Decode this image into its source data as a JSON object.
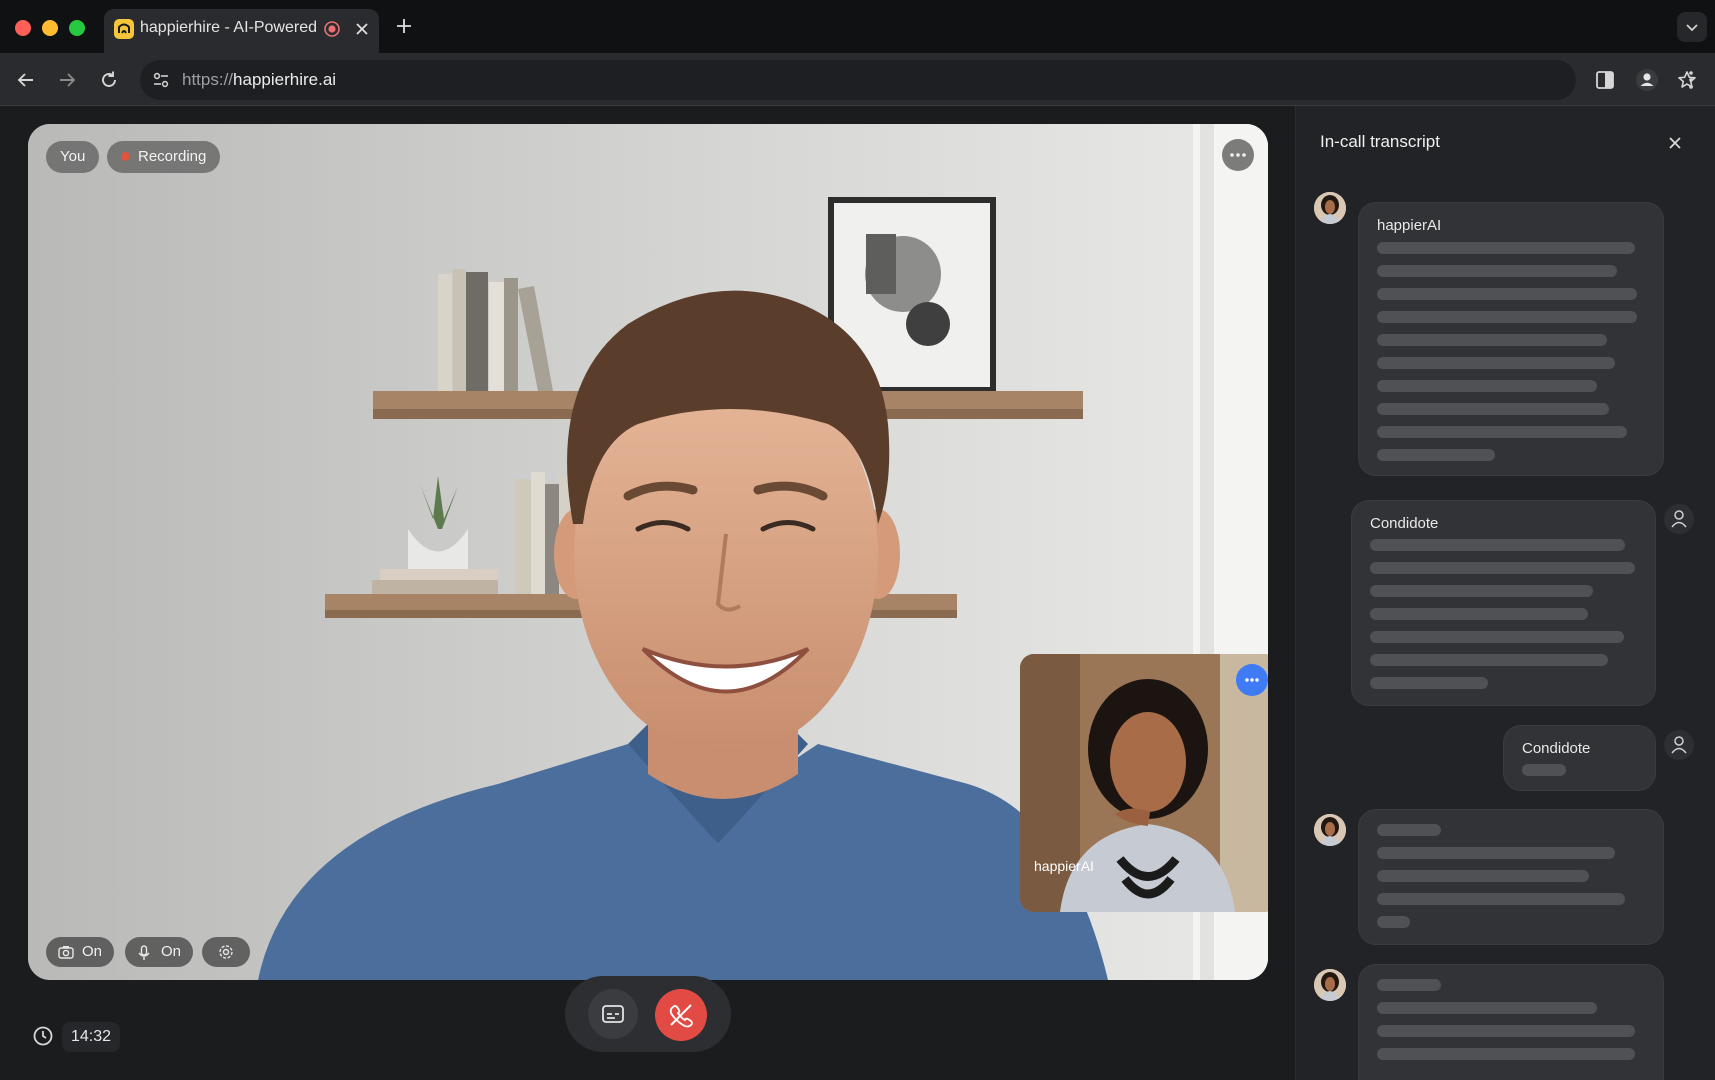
{
  "browser": {
    "tab_title": "happierhire - AI-Powered",
    "url_scheme": "https://",
    "url_host": "happierhire.ai"
  },
  "call": {
    "self_label": "You",
    "recording_label": "Recording",
    "camera_status": "On",
    "mic_status": "On",
    "elapsed_time": "14:32",
    "pip_name": "happierAI"
  },
  "transcript": {
    "title": "In-call transcript",
    "messages": [
      {
        "speaker": "happierAI"
      },
      {
        "speaker": "Condidote"
      },
      {
        "speaker": "Condidote"
      },
      {
        "speaker": ""
      },
      {
        "speaker": ""
      }
    ]
  },
  "colors": {
    "end_call": "#e24b44",
    "pip_more": "#3f7bf5",
    "recording_dot": "#e0533f"
  }
}
